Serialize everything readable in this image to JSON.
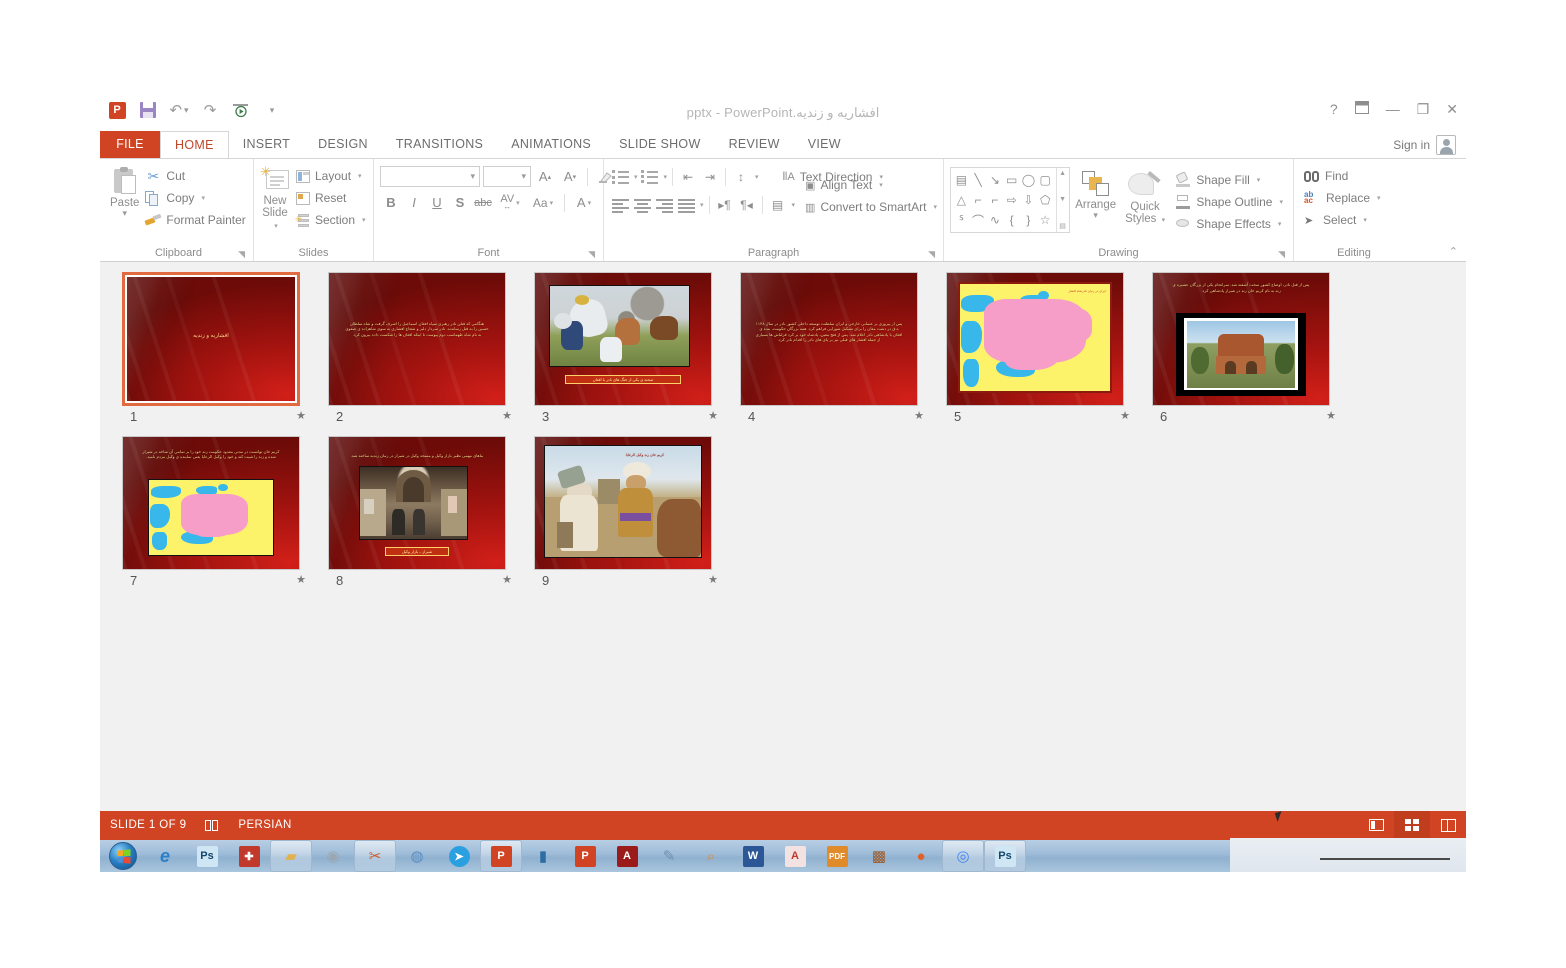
{
  "app": {
    "title": "افشاریه و زندیه.pptx - PowerPoint",
    "signin_label": "Sign in"
  },
  "quick_access": {
    "logo": "ppt-logo",
    "save": "save-icon",
    "undo": "undo-icon",
    "redo": "redo-icon",
    "start_slideshow": "slideshow-icon",
    "customize": "customize-icon"
  },
  "window_controls": {
    "help": "?",
    "ribbon_display": "ribbon-options-icon",
    "minimize": "—",
    "restore": "❐",
    "close": "✕"
  },
  "tabs": [
    {
      "label": "FILE",
      "id": "file"
    },
    {
      "label": "HOME",
      "id": "home"
    },
    {
      "label": "INSERT",
      "id": "insert"
    },
    {
      "label": "DESIGN",
      "id": "design"
    },
    {
      "label": "TRANSITIONS",
      "id": "transitions"
    },
    {
      "label": "ANIMATIONS",
      "id": "animations"
    },
    {
      "label": "SLIDE SHOW",
      "id": "slideshow"
    },
    {
      "label": "REVIEW",
      "id": "review"
    },
    {
      "label": "VIEW",
      "id": "view"
    }
  ],
  "active_tab": "HOME",
  "ribbon": {
    "clipboard": {
      "label": "Clipboard",
      "paste": "Paste",
      "cut": "Cut",
      "copy": "Copy",
      "format_painter": "Format Painter"
    },
    "slides": {
      "label": "Slides",
      "new_slide_line1": "New",
      "new_slide_line2": "Slide",
      "layout": "Layout",
      "reset": "Reset",
      "section": "Section"
    },
    "font": {
      "label": "Font",
      "font_name_value": "",
      "font_size_value": "",
      "grow_font": "A",
      "shrink_font": "A",
      "clear_formatting": "clear-formatting-icon",
      "bold": "B",
      "italic": "I",
      "underline": "U",
      "shadow": "S",
      "strikethrough": "abc",
      "character_spacing": "AV",
      "change_case": "Aa",
      "font_color": "A"
    },
    "paragraph": {
      "label": "Paragraph",
      "text_direction": "Text Direction",
      "align_text": "Align Text",
      "convert_to_smartart": "Convert to SmartArt"
    },
    "drawing": {
      "label": "Drawing",
      "arrange": "Arrange",
      "quick_styles_line1": "Quick",
      "quick_styles_line2": "Styles",
      "shape_fill": "Shape Fill",
      "shape_outline": "Shape Outline",
      "shape_effects": "Shape Effects"
    },
    "editing": {
      "label": "Editing",
      "find": "Find",
      "replace": "Replace",
      "select": "Select"
    }
  },
  "slides": [
    {
      "number": "1",
      "selected": true,
      "type": "title",
      "title": "افشاریه و زندیه"
    },
    {
      "number": "2",
      "selected": false,
      "type": "text",
      "body": "هنگامی که قتلن نادر رهبری سپاه افغان اسماعیل را اشرف گرفت و شاه سلطان حسین را به قتل رساندند. نادر سردار دلیر و شجاع افشاری به سوی شاهزاده ی صفوی به نام شاه طهماسب دوم پیوست تا اینکه افغان ها را شکست داده بیرون کرد."
    },
    {
      "number": "3",
      "selected": false,
      "type": "image_caption",
      "caption": "صحنه ی یکی از جنگ های نادر با افغان"
    },
    {
      "number": "4",
      "selected": false,
      "type": "text",
      "body": "پس از پیروزی بر عثمانی خارجی و ایران سلطنت توسعه داخلی کشور نادر در سال ۱۱۴۸ ه.ق در دشت مغان را برای تشکیل شورایی فراهم کرد. همه بزرگان حکومت، بنده ی افغان با پادشاهی نادر اعلام شد. پس از فتح معین، پادشاه خود بر کرد قزلباش ها بسیاری از جمله افشار های قبلی نیز بر پای های نادر را اقدام نادر کرد."
    },
    {
      "number": "5",
      "selected": false,
      "type": "map",
      "map_title": "ایران در زمان نادرشاه افشار"
    },
    {
      "number": "6",
      "selected": false,
      "type": "text_image",
      "body": "پس از قتل نادر، اوضاع کشور سخت آشفته شد. سرانجام یکی از بزرگان عشیره ی زند به نام کریم خان زند در شیراز پادشاهی کرد."
    },
    {
      "number": "7",
      "selected": false,
      "type": "text_map",
      "body": "کریم خان توانست در مدتی معدود حکومت زند خود را بر تمامی آن شاخه در شیراز شده و زند را تثبیت کند و خود را وکیل الرعایا یعنی نماینده ی وکیل مردم نامید."
    },
    {
      "number": "8",
      "selected": false,
      "type": "image_caption",
      "body": "بناهای مهمی نظیر بازار وکیل و مسجد وکیل در شیراز در زمان زندیه ساخته شد.",
      "caption": "شیراز – بازار وکیل"
    },
    {
      "number": "9",
      "selected": false,
      "type": "image_caption",
      "caption": "کریم خان زند وکیل الرعایا"
    }
  ],
  "status_bar": {
    "slide_counter": "SLIDE 1 OF 9",
    "notes_icon": "notes-icon",
    "language": "PERSIAN",
    "view_normal": "normal-view-icon",
    "view_sorter": "slide-sorter-view-icon",
    "view_reading": "reading-view-icon"
  },
  "taskbar": {
    "start": "windows-start-orb",
    "items": [
      {
        "name": "internet-explorer",
        "glyph": "e",
        "color": "#2b7fc9",
        "boxed": false
      },
      {
        "name": "photoshop",
        "glyph": "Ps",
        "color": "#2a6fa8",
        "boxed": false
      },
      {
        "name": "pdf-creator",
        "glyph": "✚",
        "color": "#c0392b",
        "boxed": false
      },
      {
        "name": "file-explorer",
        "glyph": "▤",
        "color": "#e3b04b",
        "boxed": true
      },
      {
        "name": "camera-app",
        "glyph": "◉",
        "color": "#9aa6b0",
        "boxed": false
      },
      {
        "name": "snipping-tool",
        "glyph": "✂",
        "color": "#d05a2a",
        "boxed": true
      },
      {
        "name": "browser-globe",
        "glyph": "◍",
        "color": "#5a8fc0",
        "boxed": false
      },
      {
        "name": "telegram",
        "glyph": "➤",
        "color": "#2ba0e0",
        "boxed": false
      },
      {
        "name": "powerpoint",
        "glyph": "P",
        "color": "#d04423",
        "boxed": true
      },
      {
        "name": "chart-app",
        "glyph": "▮",
        "color": "#2e6da4",
        "boxed": false
      },
      {
        "name": "powerpoint-doc",
        "glyph": "P",
        "color": "#d04423",
        "boxed": false
      },
      {
        "name": "adobe-acrobat",
        "glyph": "A",
        "color": "#9b1b1b",
        "boxed": false
      },
      {
        "name": "paint-tool",
        "glyph": "✎",
        "color": "#6f8fb0",
        "boxed": false
      },
      {
        "name": "search-tool",
        "glyph": "⌕",
        "color": "#e08a2a",
        "boxed": false
      },
      {
        "name": "word",
        "glyph": "W",
        "color": "#2b5797",
        "boxed": false
      },
      {
        "name": "autocad",
        "glyph": "A",
        "color": "#c0392b",
        "boxed": false
      },
      {
        "name": "pdf-reader",
        "glyph": "▦",
        "color": "#e08a2a",
        "boxed": false
      },
      {
        "name": "winrar",
        "glyph": "▩",
        "color": "#9b5a2a",
        "boxed": false
      },
      {
        "name": "firefox",
        "glyph": "●",
        "color": "#e0622a",
        "boxed": false
      },
      {
        "name": "google-chrome",
        "glyph": "◎",
        "color": "#4285f4",
        "boxed": true
      },
      {
        "name": "photoshop-open",
        "glyph": "Ps",
        "color": "#2a6fa8",
        "boxed": true
      }
    ]
  }
}
